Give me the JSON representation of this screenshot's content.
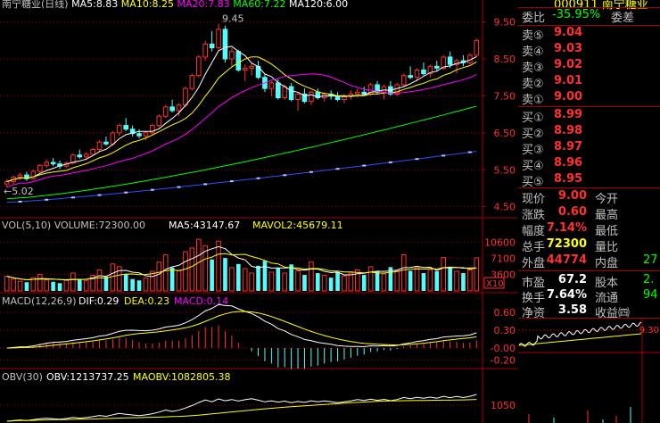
{
  "header": {
    "title_text": "南宁糖业(日线)",
    "ma_labels": [
      {
        "text": "MA5:8.83",
        "color": "#ffffff"
      },
      {
        "text": "MA10:8.25",
        "color": "#ffff00"
      },
      {
        "text": "MA20:7.83",
        "color": "#ff00ff"
      },
      {
        "text": "MA60:7.22",
        "color": "#00ff00"
      },
      {
        "text": "MA120:6.00",
        "color": "#ffffff"
      }
    ],
    "stock_code": "000911 南宁糖业"
  },
  "price_chart": {
    "y_ticks": [
      "9.50",
      "8.50",
      "7.50",
      "6.50",
      "5.50",
      "4.50"
    ],
    "y_values": [
      9.5,
      8.5,
      7.5,
      6.5,
      5.5,
      4.5
    ],
    "ylim": [
      4.3,
      9.9
    ],
    "high_marker": "9.45",
    "low_marker": "5.02"
  },
  "volume_chart": {
    "title": "VOL(5,10)",
    "volume_label": "VOLUME:72300.00",
    "ma5_label": "MA5:43147.67",
    "mavol2_label": "MAVOL2:45679.11",
    "y_ticks": [
      "10600",
      "7100",
      "3600"
    ],
    "y_values": [
      10600,
      7100,
      3600
    ],
    "ylim": [
      0,
      12500
    ],
    "unit": "X10"
  },
  "macd_chart": {
    "title": "MACD(12,26,9)",
    "dif_label": "DIF:0.29",
    "dea_label": "DEA:0.23",
    "macd_label": "MACD:0.14",
    "y_ticks": [
      "0.60",
      "0.30",
      "-0.00",
      "-0.20"
    ],
    "y_values": [
      0.6,
      0.3,
      0.0,
      -0.2
    ],
    "ylim": [
      -0.3,
      0.75
    ]
  },
  "obv_chart": {
    "title": "OBV(30)",
    "obv_label": "OBV:1213737.25",
    "maobv_label": "MAOBV:1082805.38",
    "y_ticks": [
      "1050"
    ],
    "y_values": [
      1050
    ]
  },
  "order_book": {
    "weibi_label": "委比",
    "weibi_value": "-35.95%",
    "weicha_label": "委差",
    "sells": [
      {
        "label": "卖⑤",
        "price": "9.04"
      },
      {
        "label": "卖④",
        "price": "9.03"
      },
      {
        "label": "卖③",
        "price": "9.02"
      },
      {
        "label": "卖②",
        "price": "9.01"
      },
      {
        "label": "卖①",
        "price": "9.00"
      }
    ],
    "buys": [
      {
        "label": "买①",
        "price": "8.99"
      },
      {
        "label": "买②",
        "price": "8.98"
      },
      {
        "label": "买③",
        "price": "8.97"
      },
      {
        "label": "买④",
        "price": "8.96"
      },
      {
        "label": "买⑤",
        "price": "8.95"
      }
    ]
  },
  "quote": {
    "rows": [
      {
        "l1": "现价",
        "v1": "9.00",
        "c1": "red",
        "l2": "今开",
        "v2": ""
      },
      {
        "l1": "涨跌",
        "v1": "0.60",
        "c1": "red",
        "l2": "最高",
        "v2": ""
      },
      {
        "l1": "幅度",
        "v1": "7.14%",
        "c1": "red",
        "l2": "最低",
        "v2": ""
      },
      {
        "l1": "总手",
        "v1": "72300",
        "c1": "yel",
        "l2": "量比",
        "v2": ""
      },
      {
        "l1": "外盘",
        "v1": "44774",
        "c1": "red",
        "l2": "内盘",
        "v2": "27"
      },
      {
        "l1": "市盈",
        "v1": "67.2",
        "c1": "wht",
        "l2": "股本",
        "v2": "2."
      },
      {
        "l1": "换手",
        "v1": "7.64%",
        "c1": "wht",
        "l2": "流通",
        "v2": "94"
      },
      {
        "l1": "净资",
        "v1": "3.58",
        "c1": "wht",
        "l2": "收益㈣",
        "v2": ""
      }
    ]
  },
  "minute_chart": {
    "y_ticks": [
      "9.30"
    ],
    "y_values": [
      9.3
    ]
  },
  "colors": {
    "up": "#ff3030",
    "down": "#54fcfc",
    "grid": "#a00000",
    "ma5": "#ffffff",
    "ma10": "#ffff00",
    "ma20": "#ff00ff",
    "ma60": "#00ff00",
    "ma120": "#3050ff"
  },
  "chart_data": {
    "type": "candlestick",
    "candles": [
      [
        5.12,
        5.25,
        5.02,
        5.18
      ],
      [
        5.18,
        5.35,
        5.12,
        5.3
      ],
      [
        5.3,
        5.42,
        5.22,
        5.36
      ],
      [
        5.36,
        5.45,
        5.2,
        5.26
      ],
      [
        5.26,
        5.5,
        5.24,
        5.46
      ],
      [
        5.46,
        5.66,
        5.4,
        5.62
      ],
      [
        5.62,
        5.78,
        5.55,
        5.7
      ],
      [
        5.7,
        5.82,
        5.6,
        5.66
      ],
      [
        5.66,
        5.75,
        5.52,
        5.6
      ],
      [
        5.6,
        5.72,
        5.55,
        5.68
      ],
      [
        5.68,
        5.95,
        5.65,
        5.9
      ],
      [
        5.9,
        6.05,
        5.8,
        5.85
      ],
      [
        5.85,
        5.98,
        5.75,
        5.92
      ],
      [
        5.92,
        6.1,
        5.88,
        6.05
      ],
      [
        6.05,
        6.3,
        6.0,
        6.25
      ],
      [
        6.25,
        6.4,
        6.15,
        6.2
      ],
      [
        6.2,
        6.55,
        6.15,
        6.5
      ],
      [
        6.5,
        6.75,
        6.42,
        6.7
      ],
      [
        6.7,
        6.9,
        6.55,
        6.6
      ],
      [
        6.6,
        6.7,
        6.4,
        6.48
      ],
      [
        6.48,
        6.6,
        6.35,
        6.42
      ],
      [
        6.42,
        6.55,
        6.3,
        6.5
      ],
      [
        6.5,
        6.75,
        6.45,
        6.7
      ],
      [
        6.7,
        7.0,
        6.65,
        6.95
      ],
      [
        6.95,
        7.25,
        6.9,
        7.2
      ],
      [
        7.2,
        7.4,
        7.05,
        7.1
      ],
      [
        7.1,
        7.3,
        6.95,
        7.25
      ],
      [
        7.25,
        7.75,
        7.2,
        7.7
      ],
      [
        7.7,
        8.1,
        7.65,
        8.05
      ],
      [
        8.05,
        8.6,
        8.0,
        8.55
      ],
      [
        8.55,
        9.0,
        8.45,
        8.9
      ],
      [
        8.9,
        9.25,
        8.7,
        8.8
      ],
      [
        8.8,
        9.45,
        8.75,
        9.3
      ],
      [
        9.3,
        9.4,
        8.4,
        8.5
      ],
      [
        8.5,
        8.8,
        8.3,
        8.7
      ],
      [
        8.7,
        8.75,
        8.15,
        8.2
      ],
      [
        8.2,
        8.35,
        7.9,
        8.25
      ],
      [
        8.25,
        8.4,
        8.05,
        8.3
      ],
      [
        8.3,
        8.45,
        7.95,
        8.0
      ],
      [
        8.0,
        8.1,
        7.6,
        7.7
      ],
      [
        7.7,
        7.9,
        7.5,
        7.85
      ],
      [
        7.85,
        7.95,
        7.4,
        7.45
      ],
      [
        7.45,
        7.8,
        7.4,
        7.75
      ],
      [
        7.75,
        7.85,
        7.35,
        7.4
      ],
      [
        7.4,
        7.6,
        7.1,
        7.55
      ],
      [
        7.55,
        7.7,
        7.3,
        7.35
      ],
      [
        7.35,
        7.65,
        7.25,
        7.6
      ],
      [
        7.6,
        7.7,
        7.4,
        7.45
      ],
      [
        7.45,
        7.6,
        7.35,
        7.55
      ],
      [
        7.55,
        7.65,
        7.4,
        7.5
      ],
      [
        7.5,
        7.6,
        7.35,
        7.4
      ],
      [
        7.4,
        7.55,
        7.3,
        7.5
      ],
      [
        7.5,
        7.65,
        7.4,
        7.55
      ],
      [
        7.55,
        7.7,
        7.45,
        7.6
      ],
      [
        7.6,
        7.75,
        7.5,
        7.55
      ],
      [
        7.55,
        7.85,
        7.5,
        7.8
      ],
      [
        7.8,
        7.9,
        7.55,
        7.6
      ],
      [
        7.6,
        7.8,
        7.4,
        7.75
      ],
      [
        7.75,
        7.9,
        7.5,
        7.55
      ],
      [
        7.55,
        7.85,
        7.5,
        7.8
      ],
      [
        7.8,
        8.1,
        7.75,
        8.05
      ],
      [
        8.05,
        8.3,
        7.95,
        8.0
      ],
      [
        8.0,
        8.25,
        7.9,
        8.2
      ],
      [
        8.2,
        8.4,
        8.05,
        8.1
      ],
      [
        8.1,
        8.35,
        8.0,
        8.3
      ],
      [
        8.3,
        8.45,
        8.15,
        8.25
      ],
      [
        8.25,
        8.6,
        8.2,
        8.55
      ],
      [
        8.55,
        8.7,
        8.25,
        8.35
      ],
      [
        8.35,
        8.5,
        8.1,
        8.45
      ],
      [
        8.45,
        8.6,
        8.3,
        8.4
      ],
      [
        8.4,
        8.65,
        8.35,
        8.6
      ],
      [
        8.6,
        9.05,
        8.55,
        9.0
      ]
    ],
    "volumes": [
      3200,
      2600,
      2100,
      1900,
      2900,
      3600,
      2400,
      2000,
      1700,
      2300,
      3900,
      2500,
      2300,
      3400,
      4600,
      3100,
      5900,
      5300,
      3600,
      2600,
      2300,
      2800,
      4300,
      6300,
      7900,
      5100,
      4400,
      8600,
      9400,
      11300,
      9900,
      6900,
      10900,
      7200,
      5100,
      5900,
      4900,
      3900,
      5500,
      6600,
      4100,
      5100,
      3900,
      5800,
      4400,
      3500,
      6300,
      3900,
      3400,
      2900,
      4100,
      3300,
      3900,
      4600,
      3500,
      5300,
      4300,
      3700,
      5200,
      4400,
      7900,
      4400,
      5100,
      3900,
      4700,
      4300,
      7300,
      5100,
      4300,
      3900,
      4600,
      7230
    ]
  }
}
